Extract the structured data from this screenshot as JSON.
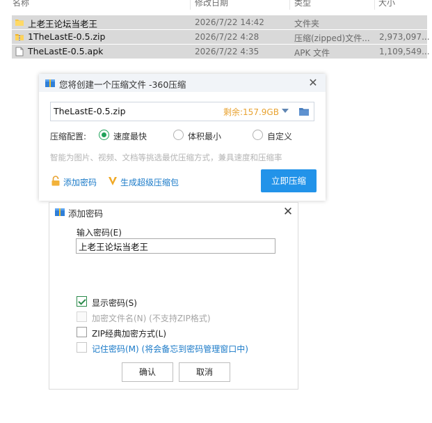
{
  "explorer": {
    "columns": [
      "名称",
      "修改日期",
      "类型",
      "大小"
    ],
    "files": [
      {
        "name": "上老王论坛当老王",
        "date": "2026/7/22 14:42",
        "type": "文件夹",
        "size": "",
        "icon": "folder-icon"
      },
      {
        "name": "1TheLastE-0.5.zip",
        "date": "2026/7/22 4:28",
        "type": "压缩(zipped)文件...",
        "size": "2,973,097...",
        "icon": "zip-icon"
      },
      {
        "name": "TheLastE-0.5.apk",
        "date": "2026/7/22 4:35",
        "type": "APK 文件",
        "size": "1,109,549...",
        "icon": "apk-icon"
      }
    ]
  },
  "compress_dialog": {
    "title": "您将创建一个压缩文件 -360压缩",
    "filename": "TheLastE-0.5.zip",
    "remaining": "剩余:157.9GB",
    "config_label": "压缩配置:",
    "options": [
      {
        "label": "速度最快",
        "selected": true
      },
      {
        "label": "体积最小",
        "selected": false
      },
      {
        "label": "自定义",
        "selected": false
      }
    ],
    "hint": "智能为图片、视频、文档等挑选最优压缩方式，兼具速度和压缩率",
    "add_password": "添加密码",
    "super_package": "生成超级压缩包",
    "compress_button": "立即压缩",
    "colors": {
      "primary": "#2293e9",
      "accent_orange": "#e8a230",
      "radio_green": "#1fa25a",
      "link_blue": "#1a7ac8"
    }
  },
  "password_dialog": {
    "title": "添加密码",
    "input_label": "输入密码(E)",
    "password_value": "上老王论坛当老王",
    "checkboxes": [
      {
        "label": "显示密码(S)",
        "checked": true,
        "disabled": false
      },
      {
        "label": "加密文件名(N) (不支持ZIP格式)",
        "checked": false,
        "disabled": true
      },
      {
        "label": "ZIP经典加密方式(L)",
        "checked": false,
        "disabled": false
      },
      {
        "label": "记住密码(M) (将会备忘到密码管理窗口中)",
        "checked": false,
        "disabled": false
      }
    ],
    "ok": "确认",
    "cancel": "取消"
  }
}
